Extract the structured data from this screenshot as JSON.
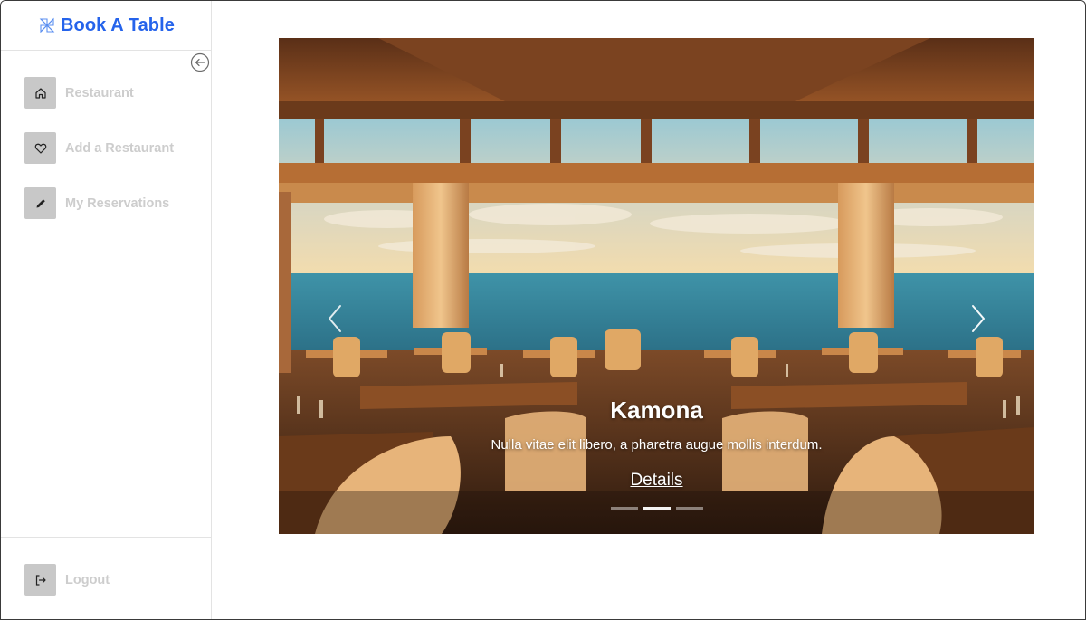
{
  "brand": {
    "title": "Book A Table",
    "logo_icon": "pinwheel-icon",
    "color": "#2563eb"
  },
  "sidebar": {
    "collapse_icon": "arrow-left-circle-icon",
    "items": [
      {
        "label": "Restaurant",
        "icon": "home-icon"
      },
      {
        "label": "Add a Restaurant",
        "icon": "heart-icon"
      },
      {
        "label": "My Reservations",
        "icon": "pencil-icon"
      }
    ],
    "logout": {
      "label": "Logout",
      "icon": "logout-icon"
    }
  },
  "carousel": {
    "slides_count": 3,
    "active_index": 1,
    "caption": {
      "title": "Kamona",
      "text": "Nulla vitae elit libero, a pharetra augue mollis interdum.",
      "link": "Details"
    },
    "prev_icon": "chevron-left-icon",
    "next_icon": "chevron-right-icon"
  }
}
